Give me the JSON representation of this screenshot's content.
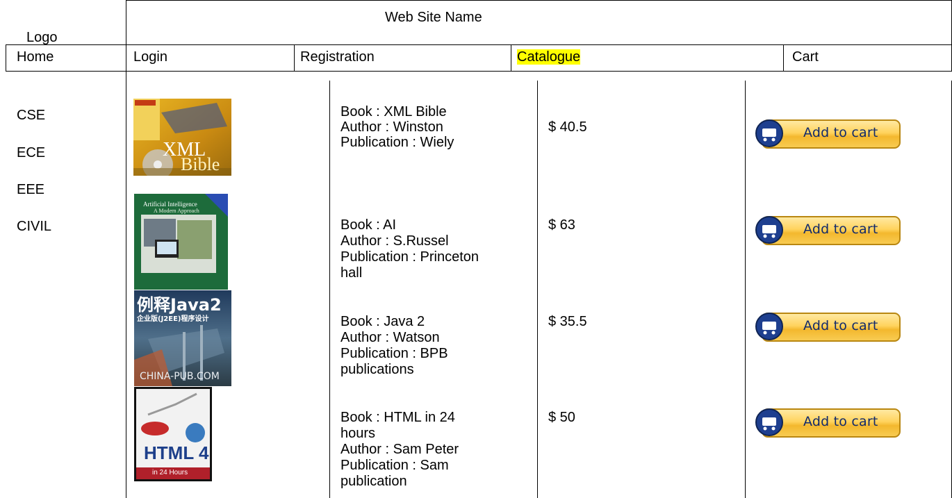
{
  "header": {
    "site_name": "Web Site Name",
    "logo": "Logo"
  },
  "nav": {
    "home": "Home",
    "login": "Login",
    "registration": "Registration",
    "catalogue": "Catalogue",
    "cart": "Cart"
  },
  "categories": [
    "CSE",
    "ECE",
    "EEE",
    "CIVIL"
  ],
  "books": [
    {
      "lines": [
        "Book :  XML Bible",
        "Author : Winston",
        "Publication : Wiely"
      ],
      "price": "$ 40.5",
      "cover_text": [
        "XML",
        "Bible"
      ]
    },
    {
      "lines": [
        "Book :  AI",
        "Author : S.Russel",
        "Publication : Princeton",
        "hall"
      ],
      "price": "$ 63",
      "cover_text": [
        "Artificial Intelligence",
        "A Modern Approach"
      ]
    },
    {
      "lines": [
        "Book : Java 2",
        "Author : Watson",
        "Publication : BPB",
        "publications"
      ],
      "price": "$ 35.5",
      "cover_text": [
        "例释Java2",
        "企业版(J2EE)程序设计",
        "CHINA-PUB.COM"
      ]
    },
    {
      "lines": [
        "Book :  HTML in 24",
        "hours",
        "Author : Sam Peter",
        "Publication : Sam",
        "publication"
      ],
      "price": "$ 50",
      "cover_text": [
        "HTML 4",
        "in 24 Hours"
      ]
    }
  ],
  "add_to_cart_label": "Add to cart",
  "colors": {
    "highlight": "#ffff00",
    "button_gold": "#f8cb52",
    "button_text": "#112a6c"
  }
}
